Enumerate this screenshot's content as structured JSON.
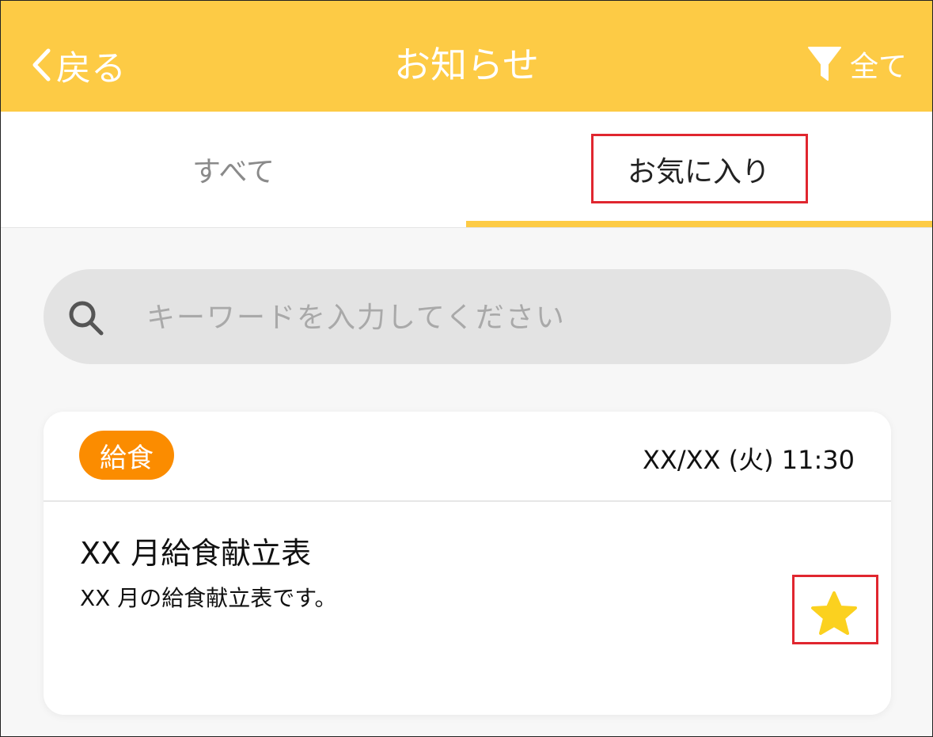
{
  "header": {
    "back_label": "戻る",
    "title": "お知らせ",
    "filter_label": "全て",
    "background": "#fdcb45"
  },
  "tabs": [
    {
      "label": "すべて",
      "selected": false
    },
    {
      "label": "お気に入り",
      "selected": true
    }
  ],
  "search": {
    "value": "",
    "placeholder": "キーワードを入力してください",
    "icon": "search-icon"
  },
  "notices": [
    {
      "category": "給食",
      "category_color": "#fb8c00",
      "date": "XX/XX (火)",
      "time": "11:30",
      "title": "XX 月給食献立表",
      "description": "XX 月の給食献立表です。",
      "favorite": true,
      "favorite_icon": "star-icon",
      "favorite_color": "#fbd11f"
    }
  ],
  "annotations": {
    "highlight_color": "#e0262f"
  }
}
